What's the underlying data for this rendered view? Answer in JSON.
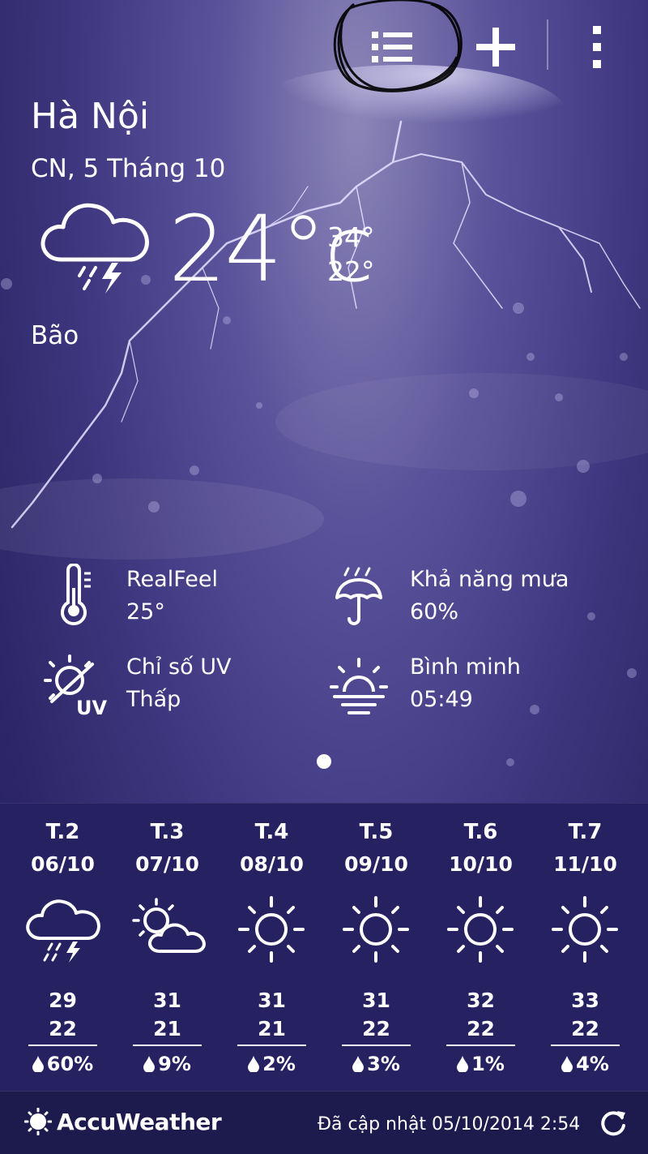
{
  "location": {
    "city": "Hà Nội",
    "date": "CN, 5 Tháng 10"
  },
  "current": {
    "temp": "24",
    "unit": "°c",
    "high": "34°",
    "low": "22°",
    "condition": "Bão",
    "icon": "thunderstorm-cloud-icon"
  },
  "details": [
    {
      "label": "RealFeel",
      "value": "25°",
      "icon": "thermometer-icon"
    },
    {
      "label": "Khả năng mưa",
      "value": "60%",
      "icon": "umbrella-rain-icon"
    },
    {
      "label": "Chỉ số UV",
      "value": "Thấp",
      "icon": "uv-sun-icon"
    },
    {
      "label": "Bình minh",
      "value": "05:49",
      "icon": "sunrise-icon"
    }
  ],
  "forecast": [
    {
      "day": "T.2",
      "date": "06/10",
      "high": "29",
      "low": "22",
      "precip": "60%",
      "icon": "thunderstorm-icon"
    },
    {
      "day": "T.3",
      "date": "07/10",
      "high": "31",
      "low": "21",
      "precip": "9%",
      "icon": "partly-cloudy-icon"
    },
    {
      "day": "T.4",
      "date": "08/10",
      "high": "31",
      "low": "21",
      "precip": "2%",
      "icon": "sun-icon"
    },
    {
      "day": "T.5",
      "date": "09/10",
      "high": "31",
      "low": "22",
      "precip": "3%",
      "icon": "sun-icon"
    },
    {
      "day": "T.6",
      "date": "10/10",
      "high": "32",
      "low": "22",
      "precip": "1%",
      "icon": "sun-icon"
    },
    {
      "day": "T.7",
      "date": "11/10",
      "high": "33",
      "low": "22",
      "precip": "4%",
      "icon": "sun-icon"
    }
  ],
  "footer": {
    "brand": "AccuWeather",
    "updated": "Đã cập nhật 05/10/2014 2:54"
  },
  "colors": {
    "forecast_bg": "#262161",
    "footer_bg": "#1d1a4e",
    "sky": "#3f377f"
  }
}
